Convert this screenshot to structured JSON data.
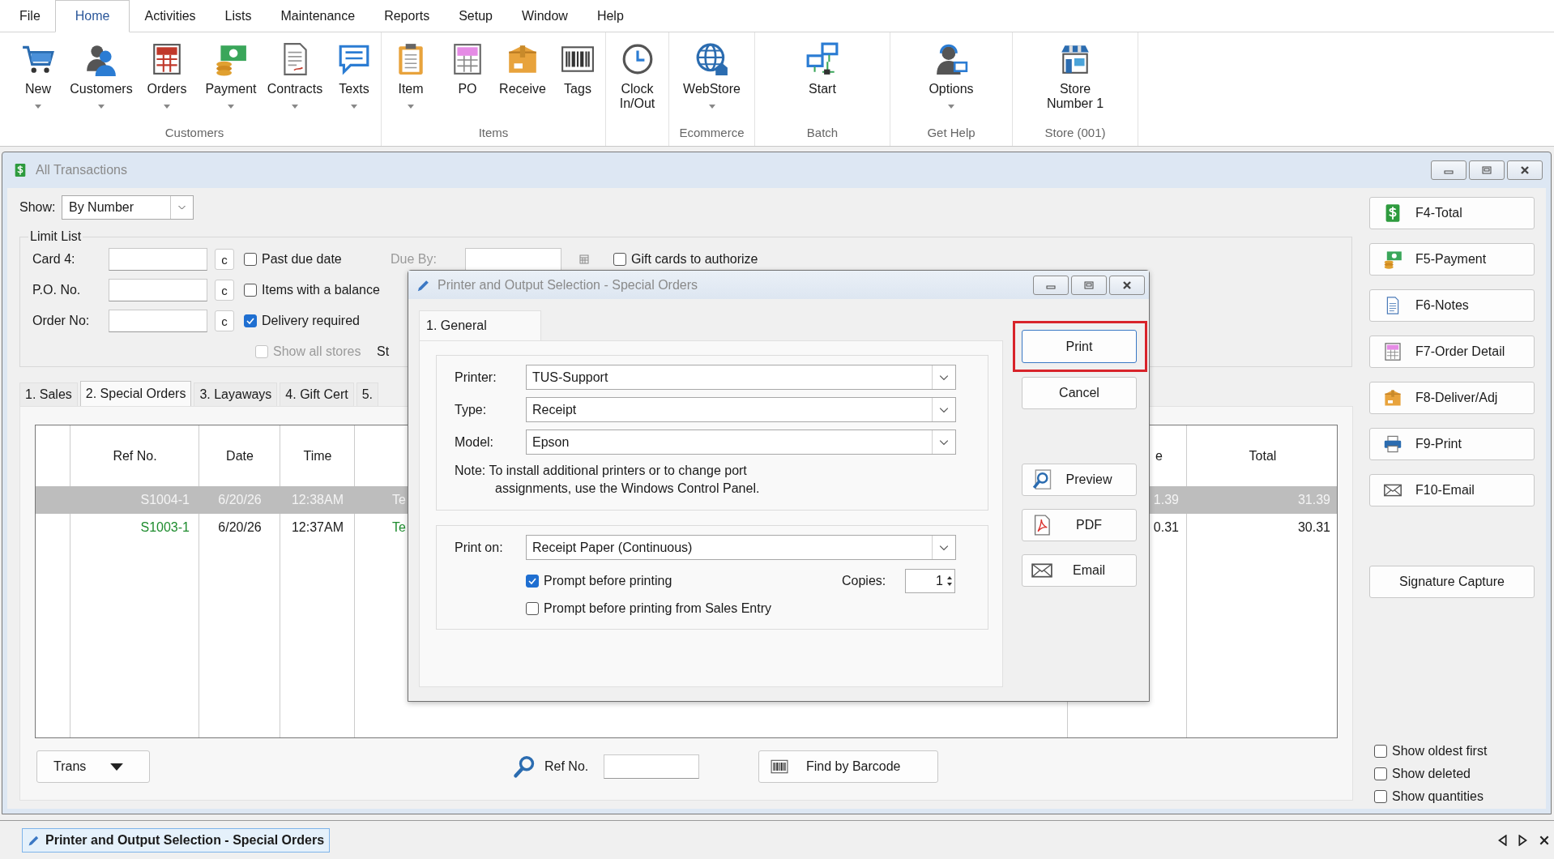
{
  "menu": [
    {
      "label": "File",
      "selected": false
    },
    {
      "label": "Home",
      "selected": true
    },
    {
      "label": "Activities",
      "selected": false
    },
    {
      "label": "Lists",
      "selected": false
    },
    {
      "label": "Maintenance",
      "selected": false
    },
    {
      "label": "Reports",
      "selected": false
    },
    {
      "label": "Setup",
      "selected": false
    },
    {
      "label": "Window",
      "selected": false
    },
    {
      "label": "Help",
      "selected": false
    }
  ],
  "ribbon": {
    "groups": [
      {
        "label": "Customers",
        "buttons": [
          {
            "label": "New",
            "dropdown": true
          },
          {
            "label": "Customers",
            "dropdown": true
          },
          {
            "label": "Orders",
            "dropdown": true
          },
          {
            "label": "Payment",
            "dropdown": true
          },
          {
            "label": "Contracts",
            "dropdown": true
          },
          {
            "label": "Texts",
            "dropdown": true
          }
        ]
      },
      {
        "label": "Items",
        "buttons": [
          {
            "label": "Item",
            "dropdown": true
          },
          {
            "label": "PO",
            "dropdown": false
          },
          {
            "label": "Receive",
            "dropdown": false
          },
          {
            "label": "Tags",
            "dropdown": false
          }
        ]
      },
      {
        "buttons": [
          {
            "label": "Clock In/Out",
            "dropdown": false
          }
        ]
      },
      {
        "label": "Ecommerce",
        "buttons": [
          {
            "label": "WebStore",
            "dropdown": true
          }
        ]
      },
      {
        "label": "Batch",
        "buttons": [
          {
            "label": "Start",
            "dropdown": false
          }
        ]
      },
      {
        "label": "Get Help",
        "buttons": [
          {
            "label": "Options",
            "dropdown": true
          }
        ]
      },
      {
        "label": "Store (001)",
        "buttons": [
          {
            "label": "Store Number 1",
            "dropdown": false
          }
        ]
      }
    ]
  },
  "window": {
    "title": "All Transactions",
    "show": {
      "label": "Show:",
      "value": "By Number"
    },
    "limit_list": {
      "title": "Limit List",
      "fields": [
        {
          "label": "Card 4:",
          "clear": "c"
        },
        {
          "label": "P.O. No.",
          "clear": "c"
        },
        {
          "label": "Order No:",
          "clear": "c"
        }
      ],
      "checks": [
        {
          "label": "Past due date",
          "checked": false,
          "disabled": false
        },
        {
          "label": "Items with a balance",
          "checked": false,
          "disabled": false
        },
        {
          "label": "Delivery required",
          "checked": true,
          "disabled": false
        },
        {
          "label": "Show all stores",
          "checked": false,
          "disabled": true
        }
      ],
      "due_by": {
        "label": "Due By:",
        "disabled": true
      },
      "gift_cards": {
        "label": "Gift cards to authorize",
        "checked": false
      },
      "cut_label": "St"
    },
    "tabs": [
      {
        "label": "1. Sales",
        "selected": false
      },
      {
        "label": "2. Special Orders",
        "selected": true
      },
      {
        "label": "3. Layaways",
        "selected": false
      },
      {
        "label": "4. Gift Cert",
        "selected": false
      },
      {
        "label": "5.",
        "selected": false
      }
    ],
    "table": {
      "columns": [
        "",
        "Ref No.",
        "Date",
        "Time",
        "",
        "e",
        "Total"
      ],
      "rows": [
        {
          "selected": true,
          "cells": [
            "",
            "S1004-1",
            "6/20/26",
            "12:38AM",
            "Te",
            "1.39",
            "31.39"
          ]
        },
        {
          "selected": false,
          "color": "#1e8c2e",
          "cells": [
            "",
            "S1003-1",
            "6/20/26",
            "12:37AM",
            "Te",
            "0.31",
            "30.31"
          ]
        }
      ]
    },
    "trans_button": "Trans",
    "ref_search": {
      "label": "Ref No."
    },
    "find_button": "Find by Barcode",
    "side_buttons": [
      "F4-Total",
      "F5-Payment",
      "F6-Notes",
      "F7-Order Detail",
      "F8-Deliver/Adj",
      "F9-Print",
      "F10-Email"
    ],
    "signature_button": "Signature Capture",
    "options": [
      {
        "label": "Show oldest first",
        "checked": false
      },
      {
        "label": "Show deleted",
        "checked": false
      },
      {
        "label": "Show quantities",
        "checked": false
      }
    ]
  },
  "dialog": {
    "title": "Printer and Output Selection - Special Orders",
    "tab": {
      "label": "1. General",
      "selected": true
    },
    "printer_fields": [
      {
        "label": "Printer:",
        "value": "TUS-Support"
      },
      {
        "label": "Type:",
        "value": "Receipt"
      },
      {
        "label": "Model:",
        "value": "Epson"
      }
    ],
    "note": "Note: To install additional printers or to change port assignments, use the Windows Control Panel.",
    "print_on": {
      "label": "Print on:",
      "value": "Receipt Paper (Continuous)",
      "checks": [
        {
          "label": "Prompt before printing",
          "checked": true
        },
        {
          "label": "Prompt before printing from Sales Entry",
          "checked": false
        }
      ],
      "copies": {
        "label": "Copies:",
        "value": "1"
      }
    },
    "actions": [
      {
        "label": "Print",
        "default": true,
        "highlighted": true
      },
      {
        "label": "Cancel",
        "default": false,
        "highlighted": false
      }
    ],
    "outputs": [
      "Preview",
      "PDF",
      "Email"
    ]
  },
  "taskbar": {
    "item": "Printer and Output Selection - Special Orders"
  }
}
